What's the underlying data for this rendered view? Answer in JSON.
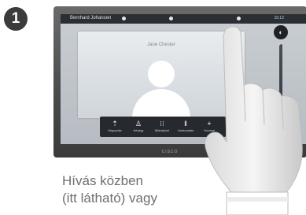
{
  "step": {
    "number": "1"
  },
  "screen": {
    "top_bar": {
      "caller": "Bernhard Johansen",
      "clock": "15:12"
    },
    "video": {
      "name": "Jane Chester"
    },
    "pager": {
      "count": 2,
      "active_index": 0
    },
    "call_bar": {
      "items": [
        {
          "icon": "share-icon",
          "label": "Megosztás",
          "glyph": "⇡"
        },
        {
          "icon": "person-icon",
          "label": "Névjegy",
          "glyph": "♙"
        },
        {
          "icon": "keypad-icon",
          "label": "Billentyűzet",
          "glyph": "⁝⁝"
        },
        {
          "icon": "hold-icon",
          "label": "Várakoztatás",
          "glyph": "‖"
        },
        {
          "icon": "add-participant-icon",
          "label": "Hozzáad",
          "glyph": "+"
        }
      ]
    },
    "side_panel": {
      "plus": "+",
      "minus": "–"
    }
  },
  "brand": {
    "logo": "CISCO"
  },
  "caption": {
    "line1": "Hívás közben",
    "line2": "(itt látható) vagy"
  },
  "colors": {
    "accent": "#38a7e0",
    "end_call": "#d71f2d",
    "step_badge": "#3b3b3b"
  }
}
